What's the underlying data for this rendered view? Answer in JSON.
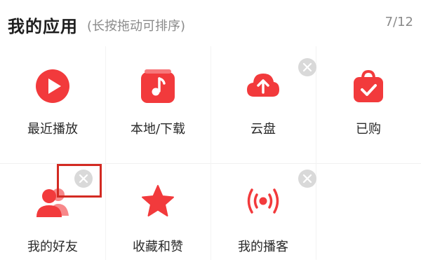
{
  "header": {
    "title": "我的应用",
    "hint": "(长按拖动可排序)",
    "count": "7/12"
  },
  "apps": [
    {
      "label": "最近播放",
      "icon": "play-icon",
      "removable": false
    },
    {
      "label": "本地/下载",
      "icon": "music-note-icon",
      "removable": false
    },
    {
      "label": "云盘",
      "icon": "cloud-upload-icon",
      "removable": true
    },
    {
      "label": "已购",
      "icon": "shopping-bag-icon",
      "removable": false
    },
    {
      "label": "我的好友",
      "icon": "friends-icon",
      "removable": true,
      "highlighted": true
    },
    {
      "label": "收藏和赞",
      "icon": "star-icon",
      "removable": false
    },
    {
      "label": "我的播客",
      "icon": "broadcast-icon",
      "removable": true
    }
  ],
  "colors": {
    "accent": "#f23a3c",
    "remove_badge": "#d9d9d9",
    "highlight_box": "#d32a22"
  }
}
